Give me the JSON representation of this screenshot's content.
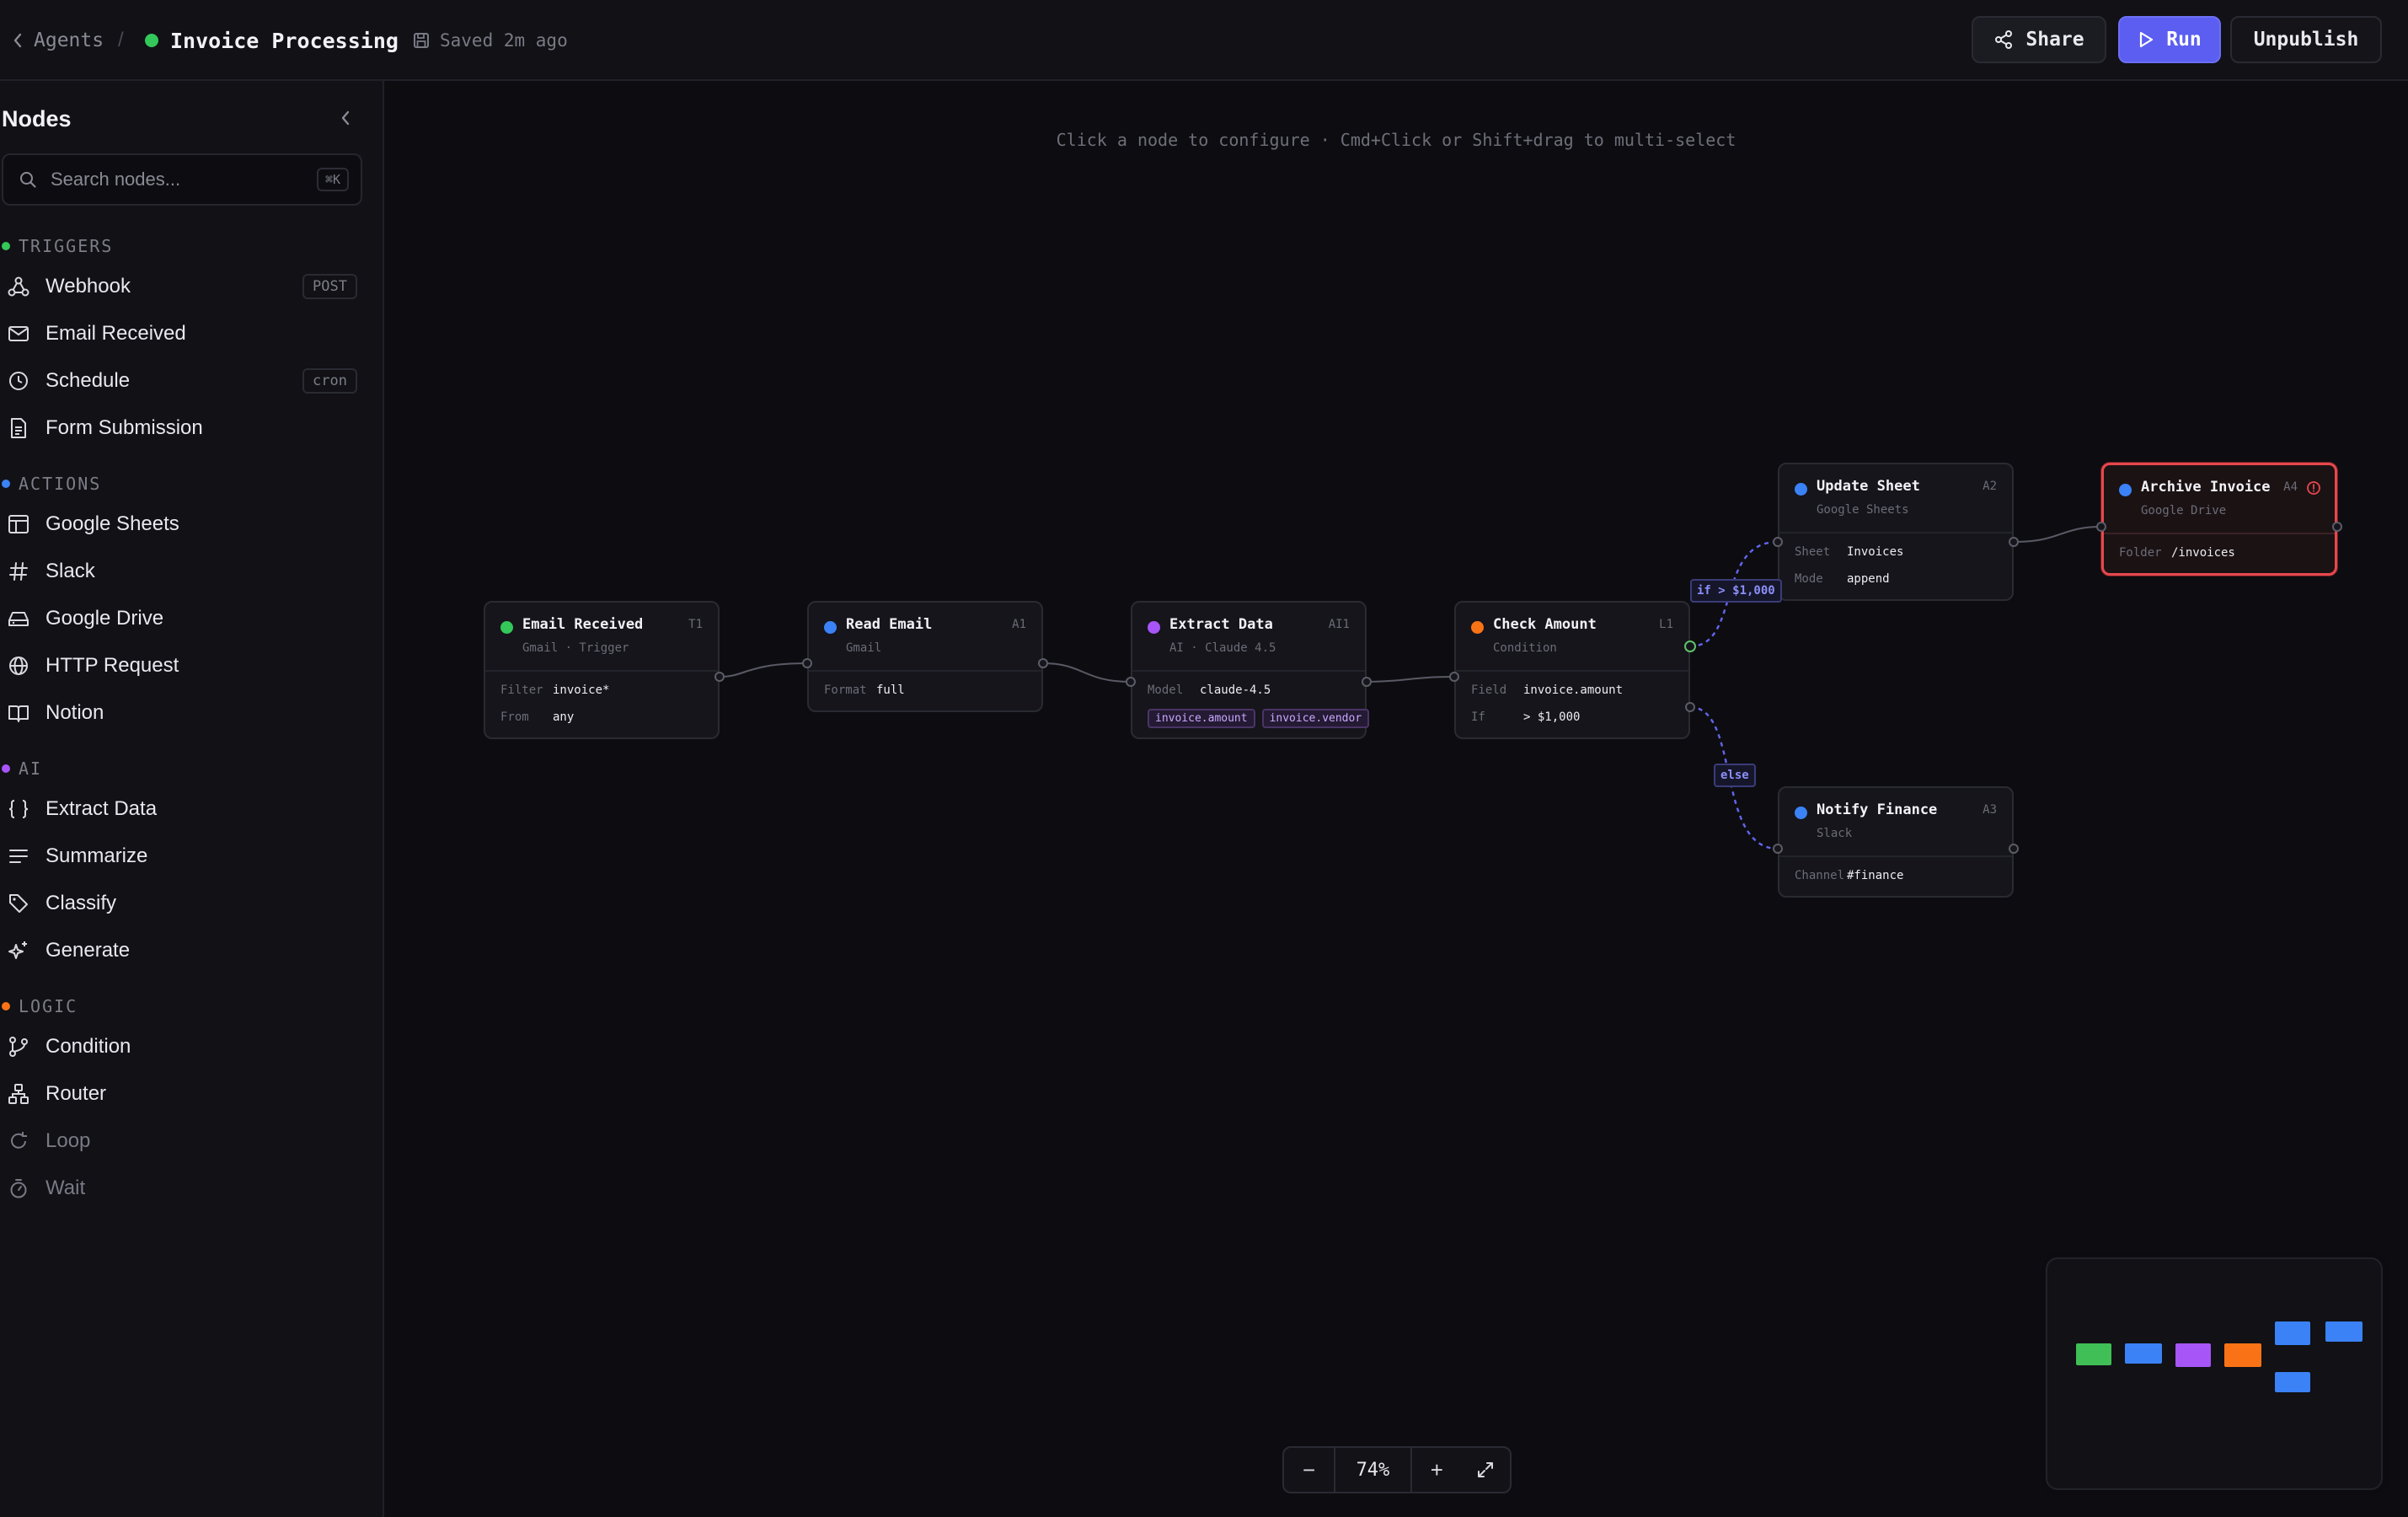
{
  "topbar": {
    "back_label": "Agents",
    "separator": "/",
    "title": "Invoice Processing",
    "status_color": "#34c759",
    "saved_text": "Saved 2m ago",
    "share_label": "Share",
    "run_label": "Run",
    "unpublish_label": "Unpublish"
  },
  "sidebar": {
    "title": "Nodes",
    "search_placeholder": "Search nodes...",
    "search_shortcut": "⌘K",
    "sections": [
      {
        "label": "TRIGGERS",
        "color": "#34c759",
        "items": [
          {
            "label": "Webhook",
            "icon": "webhook-icon",
            "tag": "POST"
          },
          {
            "label": "Email Received",
            "icon": "mail-icon"
          },
          {
            "label": "Schedule",
            "icon": "clock-icon",
            "tag": "cron"
          },
          {
            "label": "Form Submission",
            "icon": "form-icon"
          }
        ]
      },
      {
        "label": "ACTIONS",
        "color": "#3b82f6",
        "items": [
          {
            "label": "Google Sheets",
            "icon": "table-icon"
          },
          {
            "label": "Slack",
            "icon": "hash-icon"
          },
          {
            "label": "Google Drive",
            "icon": "drive-icon"
          },
          {
            "label": "HTTP Request",
            "icon": "globe-icon"
          },
          {
            "label": "Notion",
            "icon": "book-icon"
          }
        ]
      },
      {
        "label": "AI",
        "color": "#a855f7",
        "items": [
          {
            "label": "Extract Data",
            "icon": "braces-icon"
          },
          {
            "label": "Summarize",
            "icon": "lines-icon"
          },
          {
            "label": "Classify",
            "icon": "tag-icon"
          },
          {
            "label": "Generate",
            "icon": "sparkles-icon"
          }
        ]
      },
      {
        "label": "LOGIC",
        "color": "#f97316",
        "items": [
          {
            "label": "Condition",
            "icon": "git-branch-icon"
          },
          {
            "label": "Router",
            "icon": "router-icon"
          },
          {
            "label": "Loop",
            "icon": "loop-icon"
          },
          {
            "label": "Wait",
            "icon": "timer-icon"
          }
        ]
      }
    ]
  },
  "canvas": {
    "hint": "Click a node to configure · Cmd+Click or Shift+drag to multi-select",
    "nodes": {
      "email_received": {
        "title": "Email Received",
        "subtitle": "Gmail · Trigger",
        "id": "T1",
        "color": "#34c759",
        "rows": [
          {
            "key": "Filter",
            "value": "invoice*"
          },
          {
            "key": "From",
            "value": "any"
          }
        ]
      },
      "read_email": {
        "title": "Read Email",
        "subtitle": "Gmail",
        "id": "A1",
        "color": "#3b82f6",
        "rows": [
          {
            "key": "Format",
            "value": "full"
          }
        ]
      },
      "extract_data": {
        "title": "Extract Data",
        "subtitle": "AI · Claude 4.5",
        "id": "AI1",
        "color": "#a855f7",
        "rows": [
          {
            "key": "Model",
            "value": "claude-4.5"
          }
        ],
        "chips": [
          "invoice.amount",
          "invoice.vendor"
        ]
      },
      "check_amount": {
        "title": "Check Amount",
        "subtitle": "Condition",
        "id": "L1",
        "color": "#f97316",
        "rows": [
          {
            "key": "Field",
            "value": "invoice.amount"
          },
          {
            "key": "If",
            "value": "> $1,000"
          }
        ]
      },
      "update_sheet": {
        "title": "Update Sheet",
        "subtitle": "Google Sheets",
        "id": "A2",
        "color": "#3b82f6",
        "rows": [
          {
            "key": "Sheet",
            "value": "Invoices"
          },
          {
            "key": "Mode",
            "value": "append"
          }
        ]
      },
      "archive_invoice": {
        "title": "Archive Invoice",
        "subtitle": "Google Drive",
        "id": "A4",
        "color": "#3b82f6",
        "state": "error",
        "rows": [
          {
            "key": "Folder",
            "value": "/invoices"
          }
        ]
      },
      "notify_finance": {
        "title": "Notify Finance",
        "subtitle": "Slack",
        "id": "A3",
        "color": "#3b82f6",
        "rows": [
          {
            "key": "Channel",
            "value": "#finance"
          }
        ]
      }
    },
    "edge_labels": {
      "if_branch": "if > $1,000",
      "else_branch": "else"
    },
    "zoom": {
      "level": "74%",
      "minus": "−",
      "plus": "+"
    }
  },
  "colors": {
    "accent": "#5b5ef0",
    "error": "#e5484d",
    "trigger": "#34c759",
    "action": "#3b82f6",
    "ai": "#a855f7",
    "logic": "#f97316"
  }
}
